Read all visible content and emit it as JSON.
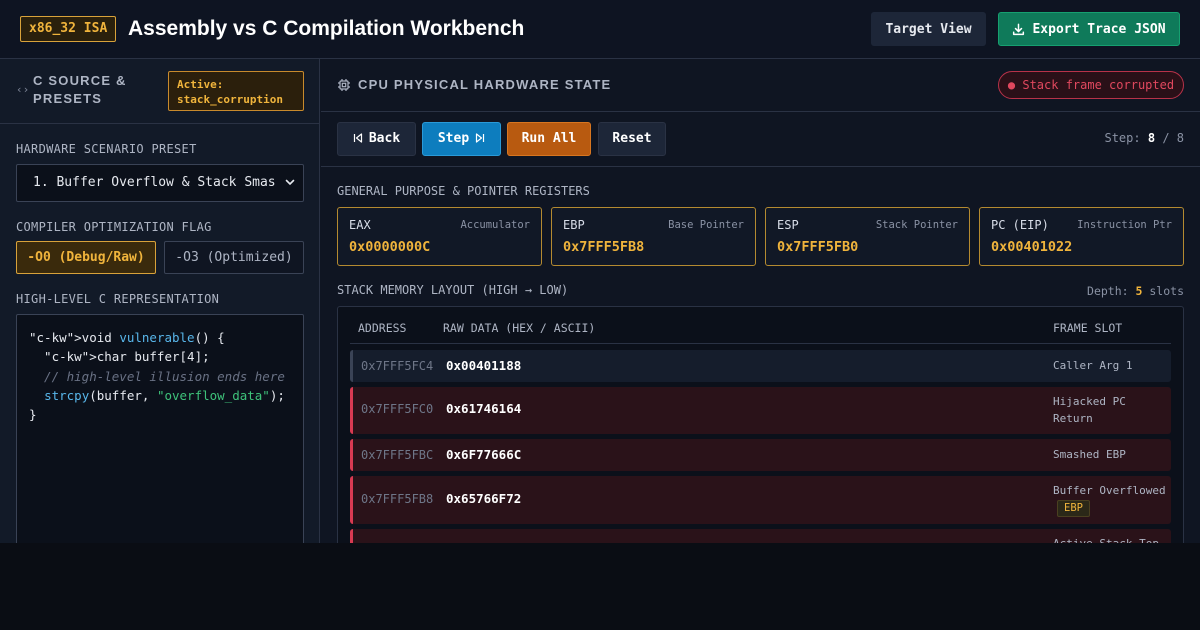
{
  "header": {
    "isa_badge": "x86_32 ISA",
    "title": "Assembly vs C Compilation Workbench",
    "target_view_label": "Target View",
    "export_label": "Export Trace JSON",
    "export_icon": "download-icon"
  },
  "left_panel": {
    "title": "C SOURCE & PRESETS",
    "title_icon": "code-brackets-icon",
    "active_badge": "Active: stack_corruption",
    "preset_label": "HARDWARE SCENARIO PRESET",
    "preset_value": "1. Buffer Overflow & Stack Smas",
    "opt_label": "COMPILER OPTIMIZATION FLAG",
    "opt_o0": "-O0 (Debug/Raw)",
    "opt_o3": "-O3 (Optimized)",
    "code_label": "HIGH-LEVEL C REPRESENTATION",
    "code": {
      "l1_pre": "\"c-kw\">void ",
      "l1_fn": "vulnerable",
      "l1_post": "() {",
      "l2": "  \"c-kw\">char buffer[4];",
      "l3": "  // high-level illusion ends here",
      "l4_indent": "  ",
      "l4_fn": "strcpy",
      "l4_mid": "(buffer, ",
      "l4_str": "\"overflow_data\"",
      "l4_post": ");",
      "l5": "}"
    }
  },
  "right_panel": {
    "title": "CPU PHYSICAL HARDWARE STATE",
    "title_icon": "cpu-chip-icon",
    "status_badge": "● Stack frame corrupted",
    "controls": {
      "back": "Back",
      "step": "Step",
      "run_all": "Run All",
      "reset": "Reset"
    },
    "step_label": "Step:",
    "step_current": "8",
    "step_total": "/ 8",
    "registers_label": "GENERAL PURPOSE & POINTER REGISTERS",
    "registers": [
      {
        "name": "EAX",
        "desc": "Accumulator",
        "value": "0x0000000C"
      },
      {
        "name": "EBP",
        "desc": "Base Pointer",
        "value": "0x7FFF5FB8"
      },
      {
        "name": "ESP",
        "desc": "Stack Pointer",
        "value": "0x7FFF5FB0"
      },
      {
        "name": "PC (EIP)",
        "desc": "Instruction Ptr",
        "value": "0x00401022"
      }
    ],
    "stack_label": "STACK MEMORY LAYOUT (HIGH → LOW)",
    "depth_label": "Depth:",
    "depth_value": "5",
    "depth_unit": "slots",
    "stack_headers": {
      "address": "ADDRESS",
      "raw": "RAW DATA (HEX / ASCII)",
      "slot": "FRAME SLOT"
    },
    "stack_rows": [
      {
        "address": "0x7FFF5FC4",
        "data": "0x00401188",
        "slot": "Caller Arg 1",
        "state": "normal"
      },
      {
        "address": "0x7FFF5FC0",
        "data": "0x61746164",
        "slot": "Hijacked PC Return",
        "state": "corrupted"
      },
      {
        "address": "0x7FFF5FBC",
        "data": "0x6F77666C",
        "slot": "Smashed EBP",
        "state": "corrupted"
      },
      {
        "address": "0x7FFF5FB8",
        "data": "0x65766F72",
        "slot": "Buffer Overflowed",
        "tag": "EBP",
        "state": "corrupted"
      },
      {
        "address": "",
        "data": "",
        "slot": "Active Stack Top",
        "state": "corrupted"
      }
    ]
  },
  "colors": {
    "accent_amber": "#f0b43c",
    "step_blue": "#0d7dbe",
    "run_orange": "#b85a10",
    "export_green": "#0f7a5a",
    "danger_red": "#d83a52"
  }
}
